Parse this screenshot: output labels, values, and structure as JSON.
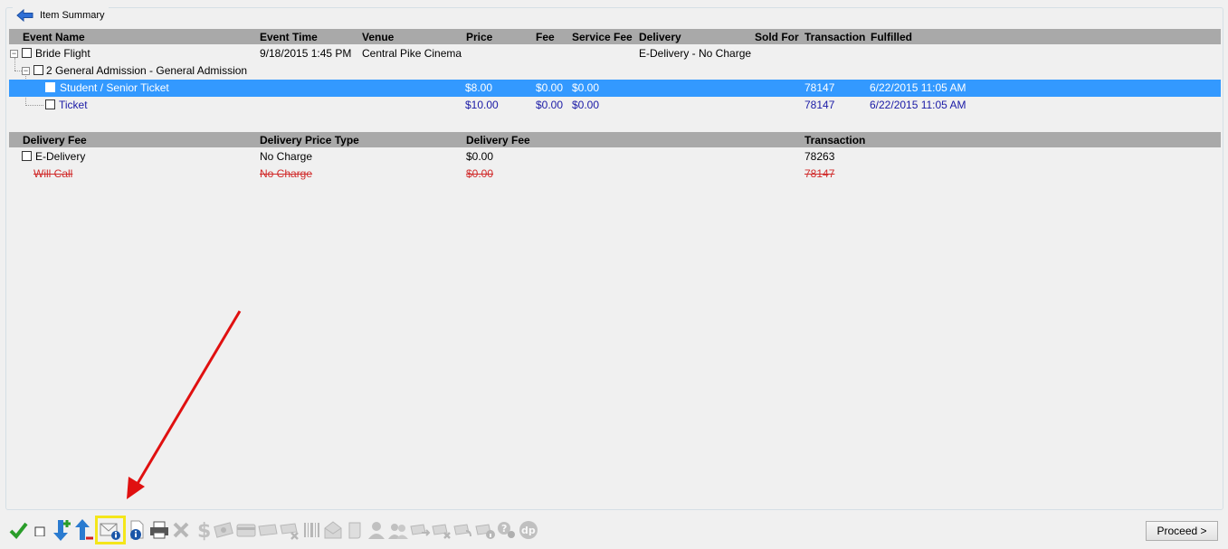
{
  "groupbox": {
    "title": "Item Summary"
  },
  "items_table": {
    "headers": [
      "Event Name",
      "Event Time",
      "Venue",
      "Price",
      "Fee",
      "Service Fee",
      "Delivery",
      "Sold For",
      "Transaction",
      "Fulfilled"
    ],
    "event": {
      "name": "Bride Flight",
      "time": "9/18/2015 1:45 PM",
      "venue": "Central Pike Cinema",
      "delivery": "E-Delivery - No Charge"
    },
    "group": {
      "name": "2 General Admission - General Admission"
    },
    "tickets": [
      {
        "name": "Student / Senior Ticket",
        "price": "$8.00",
        "fee": "$0.00",
        "service_fee": "$0.00",
        "transaction": "78147",
        "fulfilled": "6/22/2015 11:05 AM"
      },
      {
        "name": "Ticket",
        "price": "$10.00",
        "fee": "$0.00",
        "service_fee": "$0.00",
        "transaction": "78147",
        "fulfilled": "6/22/2015 11:05 AM"
      }
    ]
  },
  "delivery_table": {
    "headers": [
      "Delivery Fee",
      "Delivery Price Type",
      "Delivery Fee",
      "Transaction"
    ],
    "rows": [
      {
        "name": "E-Delivery",
        "type": "No Charge",
        "fee": "$0.00",
        "transaction": "78263",
        "struck": false
      },
      {
        "name": "Will Call",
        "type": "No Charge",
        "fee": "$0.00",
        "transaction": "78147",
        "struck": true
      }
    ]
  },
  "toolbar": {
    "icons": [
      "check-icon",
      "checkbox-icon",
      "move-down-add-icon",
      "move-up-remove-icon",
      "email-info-icon",
      "document-info-icon",
      "printer-icon",
      "delete-icon",
      "dollar-icon",
      "money-icon",
      "card-icon",
      "ticket-icon",
      "ticket-remove-icon",
      "barcode-icon",
      "envelope-open-icon",
      "scroll-icon",
      "user-icon",
      "users-icon",
      "transfer-icon",
      "transfer-remove-icon",
      "exchange-icon",
      "exchange-info-icon",
      "help-icon",
      "dp-icon"
    ],
    "highlight_color": "#f4e61a"
  },
  "proceed_button": {
    "label": "Proceed >"
  },
  "colors": {
    "selection": "#3399ff",
    "header": "#a9a9a9",
    "link_blue": "#1a1aa6",
    "strike_red": "#d12b2b",
    "arrow": "#e01010"
  }
}
